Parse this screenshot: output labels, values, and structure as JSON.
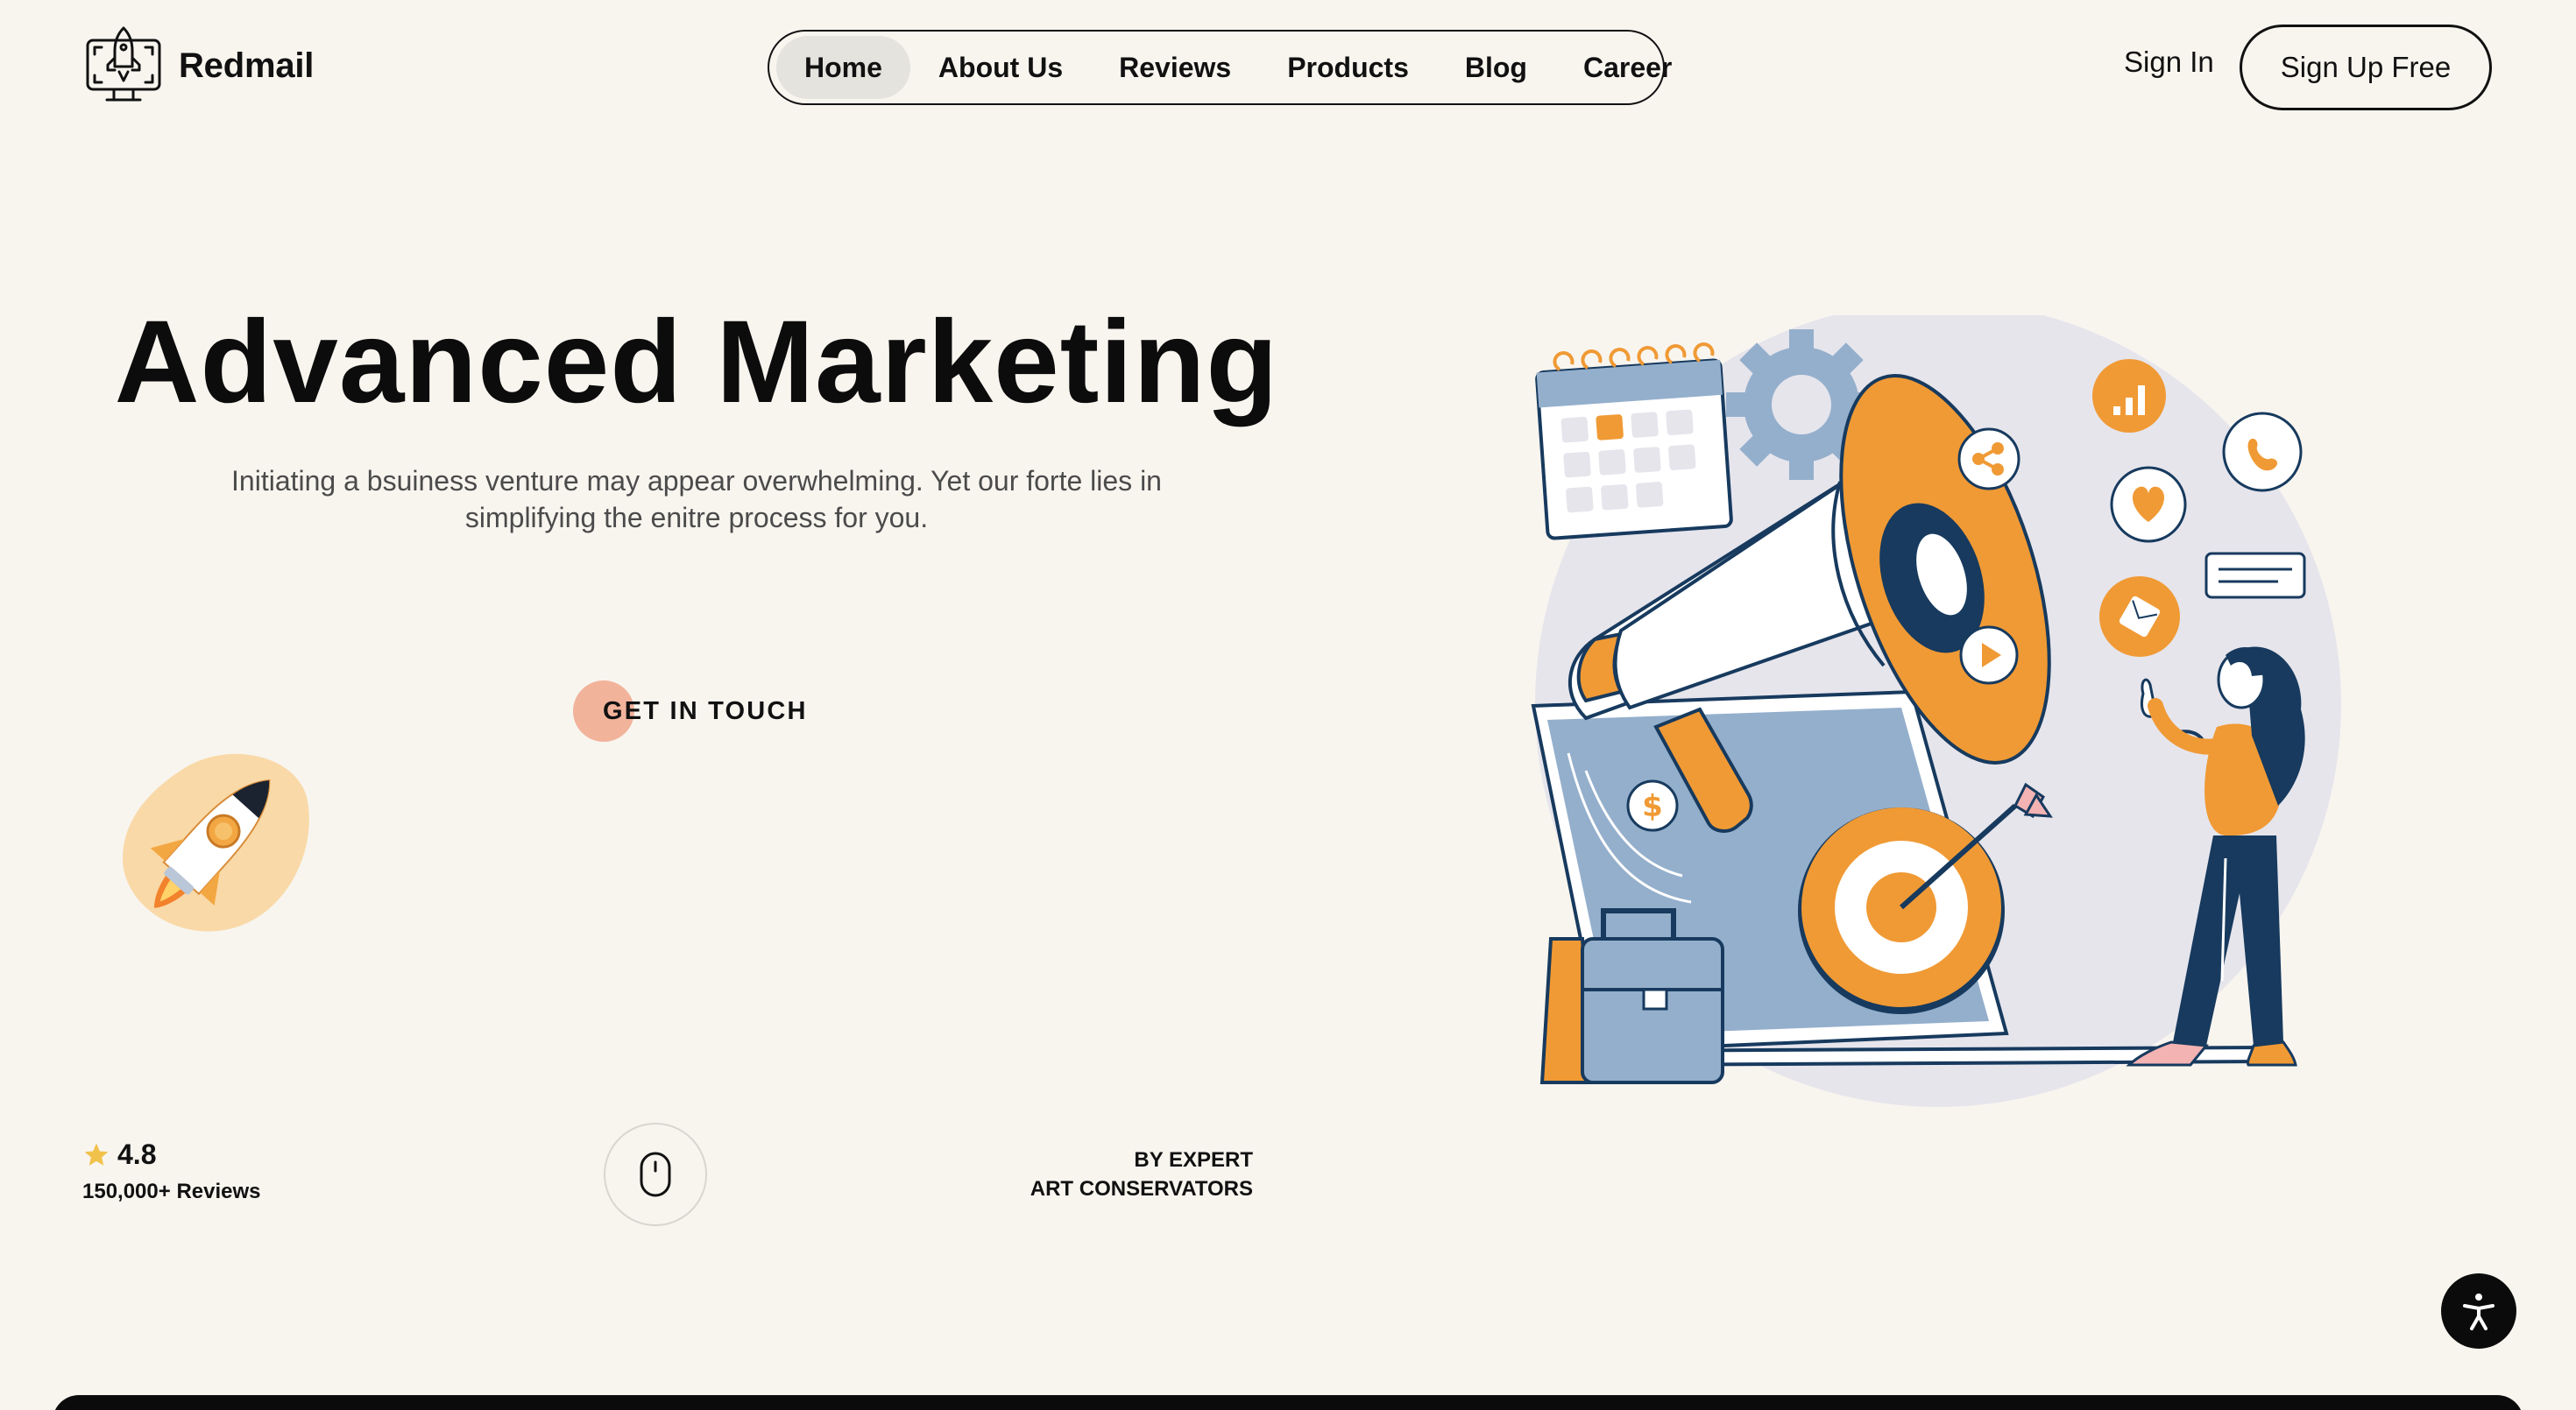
{
  "brand": {
    "name": "Redmail",
    "logo_icon": "rocket-monitor-icon"
  },
  "nav": {
    "items": [
      {
        "label": "Home",
        "active": true
      },
      {
        "label": "About Us",
        "active": false
      },
      {
        "label": "Reviews",
        "active": false
      },
      {
        "label": "Products",
        "active": false
      },
      {
        "label": "Blog",
        "active": false
      },
      {
        "label": "Career",
        "active": false
      }
    ]
  },
  "auth": {
    "sign_in": "Sign In",
    "sign_up": "Sign Up Free"
  },
  "hero": {
    "title": "Advanced Marketing",
    "subtitle": "Initiating a bsuiness venture may appear overwhelming. Yet our forte lies in simplifying the enitre process for you.",
    "cta_label": "GET IN TOUCH"
  },
  "stats": {
    "rating": "4.8",
    "reviews": "150,000+ Reviews",
    "expert_line1": "BY EXPERT",
    "expert_line2": "ART CONSERVATORS"
  },
  "colors": {
    "background": "#f8f5ef",
    "accent_orange": "#f09a35",
    "navy": "#173a5e",
    "slate_blue": "#94afcc",
    "cta_dot": "#f2b39b",
    "star": "#f1c24b"
  },
  "icons": [
    "rocket-monitor-icon",
    "star-icon",
    "mouse-scroll-icon",
    "accessibility-icon",
    "rocket-illustration",
    "marketing-megaphone-illustration"
  ]
}
